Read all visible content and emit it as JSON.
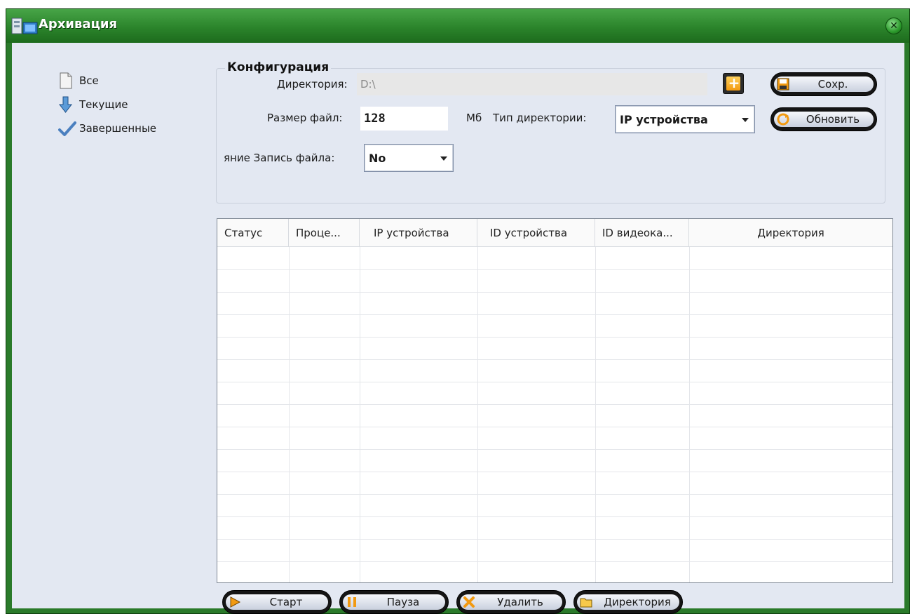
{
  "window": {
    "title": "Архивация",
    "close_glyph": "✕"
  },
  "sidebar": {
    "items": [
      {
        "label": "Все",
        "icon": "document-icon"
      },
      {
        "label": "Текущие",
        "icon": "down-arrow-icon"
      },
      {
        "label": "Завершенные",
        "icon": "checkmark-icon"
      }
    ]
  },
  "config": {
    "title": "Конфигурация",
    "dir_label": "Директория:",
    "dir_value": "D:\\",
    "size_label": "Размер файл:",
    "size_value": "128",
    "size_unit": "Мб",
    "dirtype_label": "Тип директории:",
    "dirtype_value": "IP устройства",
    "record_label": "яние Запись файла:",
    "record_value": "No",
    "add_glyph": "+",
    "save_label": "Сохр.",
    "refresh_label": "Обновить"
  },
  "table": {
    "columns": [
      "Статус",
      "Проце...",
      "IP устройства",
      "ID устройства",
      "ID видеока...",
      "Директория"
    ],
    "rows": []
  },
  "actions": {
    "start_label": "Старт",
    "pause_label": "Пауза",
    "delete_label": "Удалить",
    "directory_label": "Директория"
  },
  "colors": {
    "titlebar": "#2b842b",
    "client_bg": "#e3e8f2",
    "accent_orange": "#f29a11"
  }
}
